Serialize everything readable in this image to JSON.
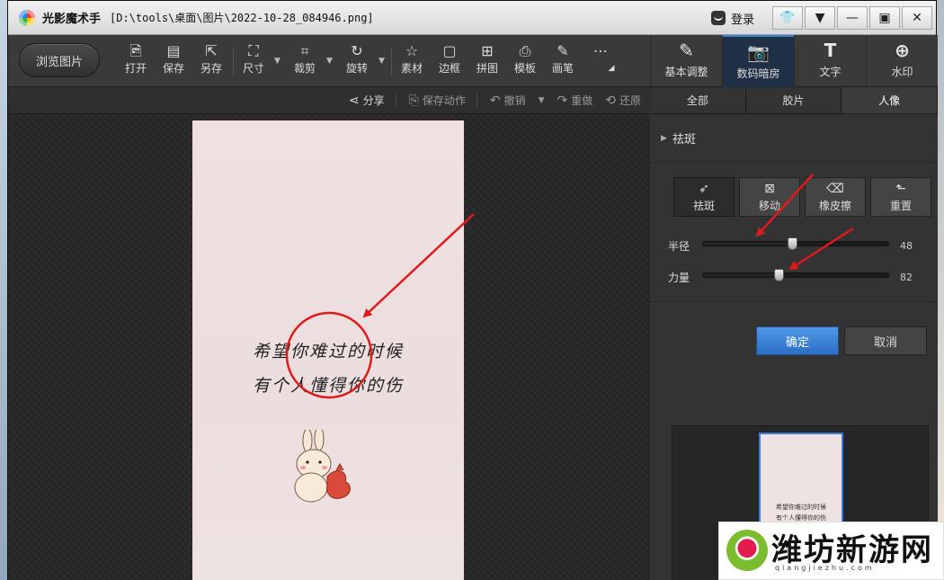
{
  "window": {
    "app_name": "光影魔术手",
    "file_path": "[D:\\tools\\桌面\\图片\\2022-10-28_084946.png]",
    "login_label": "登录",
    "controls": {
      "skin": "skin-icon",
      "menu": "menu-icon",
      "minimize": "minimize-icon",
      "maximize": "maximize-icon",
      "close": "close-icon"
    }
  },
  "toolbar": {
    "browse_label": "浏览图片",
    "items": [
      {
        "label": "打开",
        "icon": "open-icon"
      },
      {
        "label": "保存",
        "icon": "save-icon"
      },
      {
        "label": "另存",
        "icon": "save-as-icon"
      },
      {
        "label": "尺寸",
        "icon": "resize-icon"
      },
      {
        "label": "裁剪",
        "icon": "crop-icon"
      },
      {
        "label": "旋转",
        "icon": "rotate-icon"
      },
      {
        "label": "素材",
        "icon": "material-icon"
      },
      {
        "label": "边框",
        "icon": "border-icon"
      },
      {
        "label": "拼图",
        "icon": "collage-icon"
      },
      {
        "label": "模板",
        "icon": "template-icon"
      },
      {
        "label": "画笔",
        "icon": "brush-icon"
      },
      {
        "label": "",
        "icon": "more-icon"
      }
    ]
  },
  "modes": [
    {
      "label": "基本调整",
      "icon": "basic-adjust-icon",
      "active": false
    },
    {
      "label": "数码暗房",
      "icon": "darkroom-icon",
      "active": true
    },
    {
      "label": "文字",
      "icon": "text-icon",
      "active": false
    },
    {
      "label": "水印",
      "icon": "watermark-icon",
      "active": false
    }
  ],
  "subbar": {
    "share": "分享",
    "save_action": "保存动作",
    "undo": "撤销",
    "redo": "重做",
    "restore": "还原"
  },
  "photo": {
    "line1": "希望你难过的时候",
    "line2": "有个人懂得你的伤"
  },
  "panel": {
    "tabs": [
      "全部",
      "胶片",
      "人像"
    ],
    "active_tab": "人像",
    "section_title": "祛斑",
    "tool_buttons": [
      {
        "label": "祛斑",
        "icon": "spot-removal-icon",
        "active": true
      },
      {
        "label": "移动",
        "icon": "move-icon",
        "active": false
      },
      {
        "label": "橡皮擦",
        "icon": "eraser-icon",
        "active": false
      },
      {
        "label": "重置",
        "icon": "reset-icon",
        "active": false
      }
    ],
    "sliders": [
      {
        "label": "半径",
        "value": 48,
        "max": 100
      },
      {
        "label": "力量",
        "value": 82,
        "max": 200
      }
    ],
    "ok_label": "确定",
    "cancel_label": "取消",
    "thumbnail": {
      "line1": "希望你难过的时候",
      "line2": "有个人懂得你的伤"
    }
  },
  "watermark": {
    "text": "潍坊新游网",
    "url": "qiangjiezhu.com"
  },
  "colors": {
    "accent": "#3c83d8",
    "ok_button": "#3a84d8",
    "annotation": "#e01a1a"
  }
}
